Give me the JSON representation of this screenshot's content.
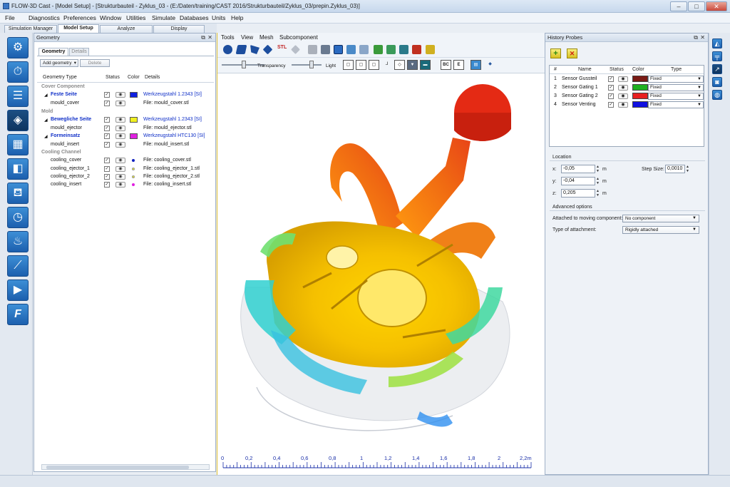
{
  "window": {
    "title": "FLOW-3D Cast - [Model Setup] - [Strukturbauteil - Zyklus_03 - (E:/Daten/training/CAST 2016/Strukturbauteil/Zyklus_03/prepin.Zyklus_03)]",
    "controls": {
      "minimize": "–",
      "maximize": "□",
      "close": "✕"
    }
  },
  "menubar": [
    "File",
    "Diagnostics",
    "Preferences",
    "Window",
    "Utilities",
    "Simulate",
    "Databases",
    "Units",
    "Help"
  ],
  "main_tabs": [
    {
      "label": "Simulation Manager",
      "active": false
    },
    {
      "label": "Model Setup",
      "active": true
    },
    {
      "label": "Analyze",
      "active": false
    },
    {
      "label": "Display",
      "active": false
    }
  ],
  "left_toolbar_icons": [
    "gear-icon",
    "stopwatch-icon",
    "layers-icon",
    "geometry-icon",
    "mesh-cube-icon",
    "box-icon",
    "ladle-icon",
    "timer-icon",
    "heat-icon",
    "graph-icon",
    "play-icon",
    "flow-logo-icon"
  ],
  "geometry_panel": {
    "title": "Geometry",
    "tabs": [
      {
        "label": "Geometry",
        "active": true
      },
      {
        "label": "Details",
        "active": false
      }
    ],
    "add_button": "Add geometry",
    "delete_button": "Delete",
    "columns": [
      "Geometry Type",
      "Status",
      "Color",
      "Details"
    ],
    "rows": [
      {
        "type": "group",
        "name": "Cover Component"
      },
      {
        "type": "item",
        "name": "Feste Seite",
        "bold": true,
        "checked": true,
        "eye": true,
        "swatch": "#1020e0",
        "details": "Werkzeugstahl 1.2343 [SI]",
        "details_link": true
      },
      {
        "type": "sub",
        "name": "mould_cover",
        "checked": true,
        "eye": true,
        "details": "File: mould_cover.stl"
      },
      {
        "type": "group",
        "name": "Mold"
      },
      {
        "type": "item",
        "name": "Bewegliche Seite",
        "bold": true,
        "checked": true,
        "eye": true,
        "swatch": "#f0f020",
        "details": "Werkzeugstahl 1.2343 [SI]",
        "details_link": true
      },
      {
        "type": "sub",
        "name": "mould_ejector",
        "checked": true,
        "eye": true,
        "details": "File: mould_ejector.stl"
      },
      {
        "type": "item",
        "name": "Formeinsatz",
        "bold": true,
        "checked": true,
        "eye": true,
        "swatch": "#e020e0",
        "details": "Werkzeugstahl HTC130 [SI]",
        "details_link": true
      },
      {
        "type": "sub",
        "name": "mould_insert",
        "checked": true,
        "eye": true,
        "details": "File: mould_insert.stl"
      },
      {
        "type": "group",
        "name": "Cooling Channel"
      },
      {
        "type": "sub",
        "name": "cooling_cover",
        "checked": true,
        "eye": true,
        "dot": "#1020c0",
        "details": "File: cooling_cover.stl"
      },
      {
        "type": "sub",
        "name": "cooling_ejector_1",
        "checked": true,
        "eye": true,
        "dot": "#e8e820",
        "details": "File: cooling_ejector_1.stl"
      },
      {
        "type": "sub",
        "name": "cooling_ejector_2",
        "checked": true,
        "eye": true,
        "dot": "#e8e820",
        "details": "File: cooling_ejector_2.stl"
      },
      {
        "type": "sub",
        "name": "cooling_insert",
        "checked": true,
        "eye": true,
        "dot": "#e020e0",
        "details": "File: cooling_insert.stl"
      }
    ]
  },
  "viewport": {
    "menu": [
      "Tools",
      "View",
      "Mesh",
      "Subcomponent"
    ],
    "transparency_label": "Transparency",
    "light_label": "Light",
    "bc_label": "BC",
    "e_label": "E",
    "ruler": {
      "ticks": [
        "0",
        "0,2",
        "0,4",
        "0,6",
        "0,8",
        "1",
        "1,2",
        "1,4",
        "1,6",
        "1,8",
        "2",
        "2,2m"
      ]
    }
  },
  "history_probes": {
    "title": "History Probes",
    "add_icon": "plus-icon",
    "remove_icon": "x-icon",
    "columns": [
      "#",
      "Name",
      "Status",
      "Color",
      "Type"
    ],
    "rows": [
      {
        "num": "1",
        "name": "Sensor Gussteil",
        "color": "#7a1a14",
        "type": "Fixed"
      },
      {
        "num": "2",
        "name": "Sensor Gating 1",
        "color": "#20b020",
        "type": "Fixed"
      },
      {
        "num": "3",
        "name": "Sensor Gating 2",
        "color": "#e82020",
        "type": "Fixed"
      },
      {
        "num": "4",
        "name": "Sensor Venting",
        "color": "#1010e0",
        "type": "Fixed"
      }
    ],
    "location_label": "Location",
    "x_label": "x:",
    "x_value": "-0,05",
    "y_label": "y:",
    "y_value": "-0,04",
    "z_label": "z:",
    "z_value": "0,205",
    "unit": "m",
    "step_label": "Step Size:",
    "step_value": "0,0010",
    "advanced_label": "Advanced options",
    "attached_label": "Attached to moving component:",
    "attached_value": "No component",
    "attachment_label": "Type of attachment:",
    "attachment_value": "Rigidly attached"
  }
}
